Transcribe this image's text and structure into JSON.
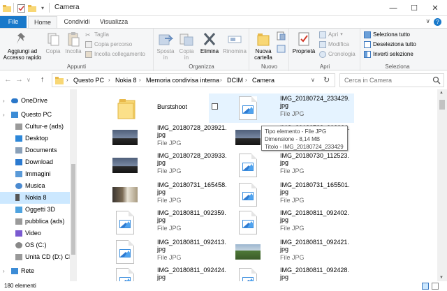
{
  "window": {
    "title": "Camera",
    "controls": {
      "minimize": "—",
      "maximize": "☐",
      "close": "✕"
    }
  },
  "tabs": {
    "file": "File",
    "home": "Home",
    "share": "Condividi",
    "view": "Visualizza"
  },
  "ribbon": {
    "clipboard": {
      "label": "Appunti",
      "pin": "Aggiungi ad Accesso rapido",
      "copy": "Copia",
      "paste": "Incolla",
      "cut": "Taglia",
      "copy_path": "Copia percorso",
      "paste_shortcut": "Incolla collegamento"
    },
    "organize": {
      "label": "Organizza",
      "move_to": "Sposta in",
      "copy_to": "Copia in",
      "delete": "Elimina",
      "rename": "Rinomina"
    },
    "new": {
      "label": "Nuovo",
      "new_folder": "Nuova cartella"
    },
    "open": {
      "label": "Apri",
      "properties": "Proprietà",
      "open": "Apri",
      "edit": "Modifica",
      "history": "Cronologia"
    },
    "select": {
      "label": "Seleziona",
      "select_all": "Seleziona tutto",
      "select_none": "Deseleziona tutto",
      "invert": "Inverti selezione"
    }
  },
  "address": {
    "crumbs": [
      "Questo PC",
      "Nokia 8",
      "Memoria condivisa interna",
      "DCIM",
      "Camera"
    ],
    "search_placeholder": "Cerca in Camera"
  },
  "nav": [
    {
      "label": "OneDrive",
      "icon": "cloud-icon",
      "indent": 0
    },
    {
      "label": "Questo PC",
      "icon": "computer-icon",
      "indent": 0
    },
    {
      "label": "Cultur-e (ads)",
      "icon": "drive-icon",
      "indent": 1
    },
    {
      "label": "Desktop",
      "icon": "desktop-icon",
      "indent": 1
    },
    {
      "label": "Documents",
      "icon": "documents-icon",
      "indent": 1
    },
    {
      "label": "Download",
      "icon": "download-icon",
      "indent": 1
    },
    {
      "label": "Immagini",
      "icon": "pictures-icon",
      "indent": 1
    },
    {
      "label": "Musica",
      "icon": "music-icon",
      "indent": 1
    },
    {
      "label": "Nokia 8",
      "icon": "phone-icon",
      "indent": 1,
      "selected": true
    },
    {
      "label": "Oggetti 3D",
      "icon": "objects-3d-icon",
      "indent": 1
    },
    {
      "label": "pubblica (ads)",
      "icon": "drive-icon",
      "indent": 1
    },
    {
      "label": "Video",
      "icon": "video-icon",
      "indent": 1
    },
    {
      "label": "OS (C:)",
      "icon": "disk-icon",
      "indent": 1
    },
    {
      "label": "Unità CD (D:) CD",
      "icon": "cd-drive-icon",
      "indent": 1
    },
    {
      "label": "Rete",
      "icon": "network-icon",
      "indent": 0
    }
  ],
  "files": [
    {
      "name": "Burstshoot",
      "type": "",
      "thumb": "folder"
    },
    {
      "name": "IMG_20180724_233429.jpg",
      "type": "File JPG",
      "thumb": "doc",
      "selected": true
    },
    {
      "name": "IMG_20180728_203921.jpg",
      "type": "File JPG",
      "thumb": "dusk"
    },
    {
      "name": "IMG_20180728_203936.jpg",
      "type": "File JPG",
      "thumb": "dusk"
    },
    {
      "name": "IMG_20180728_203933.jpg",
      "type": "File JPG",
      "thumb": "dusk"
    },
    {
      "name": "IMG_20180730_112523.jpg",
      "type": "File JPG",
      "thumb": "doc"
    },
    {
      "name": "IMG_20180731_165458.jpg",
      "type": "File JPG",
      "thumb": "room"
    },
    {
      "name": "IMG_20180731_165501.jpg",
      "type": "File JPG",
      "thumb": "doc"
    },
    {
      "name": "IMG_20180811_092359.jpg",
      "type": "File JPG",
      "thumb": "doc"
    },
    {
      "name": "IMG_20180811_092402.jpg",
      "type": "File JPG",
      "thumb": "doc"
    },
    {
      "name": "IMG_20180811_092413.jpg",
      "type": "File JPG",
      "thumb": "doc"
    },
    {
      "name": "IMG_20180811_092421.jpg",
      "type": "File JPG",
      "thumb": "garden"
    },
    {
      "name": "IMG_20180811_092424.jpg",
      "type": "File JPG",
      "thumb": "doc"
    },
    {
      "name": "IMG_20180811_092428.jpg",
      "type": "File JPG",
      "thumb": "doc"
    }
  ],
  "tooltip": {
    "type": "Tipo elemento - File JPG",
    "size": "Dimensione - 8,14 MB",
    "title": "Titolo - IMG_20180724_233429"
  },
  "status": {
    "count": "180 elementi"
  },
  "colors": {
    "accent": "#1979ca",
    "selection": "#cce8ff",
    "folder": "#f8d775"
  }
}
